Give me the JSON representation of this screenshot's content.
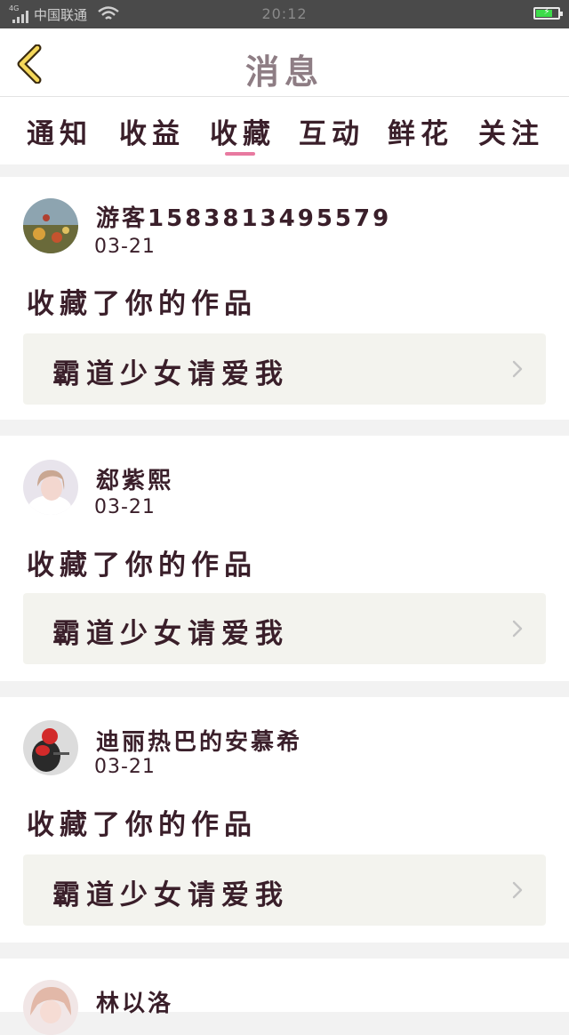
{
  "status_bar": {
    "network": "4G",
    "carrier": "中国联通",
    "time": "20:12",
    "battery_level": 0.75
  },
  "header": {
    "title": "消息",
    "back_icon": "back-arrow-icon"
  },
  "tabs": [
    {
      "label": "通知"
    },
    {
      "label": "收益"
    },
    {
      "label": "收藏"
    },
    {
      "label": "互动"
    },
    {
      "label": "鲜花"
    },
    {
      "label": "关注"
    }
  ],
  "active_tab_index": 2,
  "colors": {
    "accent": "#e87aa0",
    "title": "#8e7d84",
    "text": "#3a1f2a",
    "card_inner_bg": "#f3f3ee"
  },
  "notifications": [
    {
      "username": "游客1583813495579",
      "date": "03-21",
      "action": "收藏了你的作品",
      "work_title": "霸道少女请爱我"
    },
    {
      "username": "郄紫熙",
      "date": "03-21",
      "action": "收藏了你的作品",
      "work_title": "霸道少女请爱我"
    },
    {
      "username": "迪丽热巴的安慕希",
      "date": "03-21",
      "action": "收藏了你的作品",
      "work_title": "霸道少女请爱我"
    },
    {
      "username": "林以洛"
    }
  ]
}
